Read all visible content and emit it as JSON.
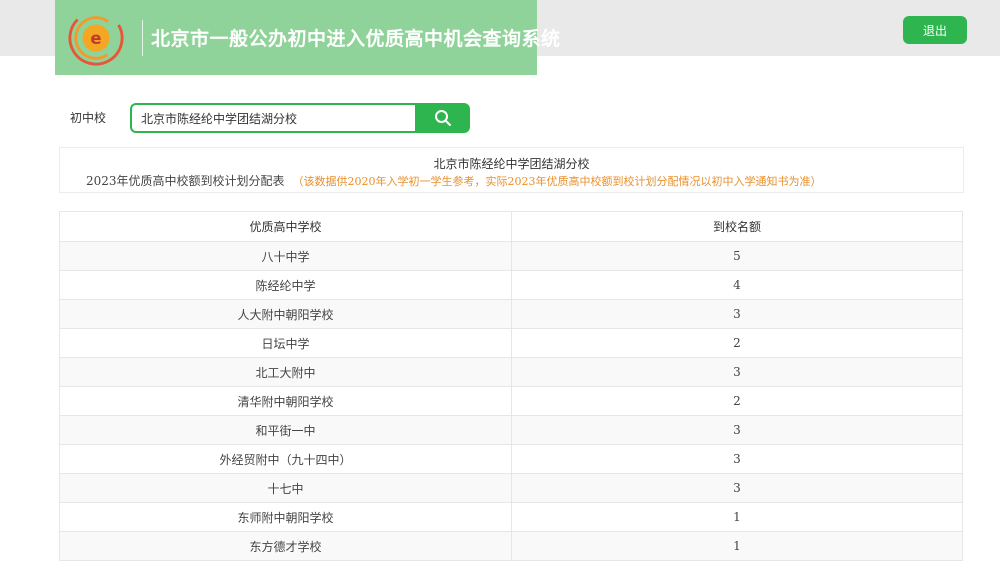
{
  "header": {
    "title": "北京市一般公办初中进入优质高中机会查询系统",
    "logout_label": "退出",
    "brand_color": "#8fd39a",
    "accent_color": "#2fb550"
  },
  "search": {
    "label": "初中校",
    "value": "北京市陈经纶中学团结湖分校",
    "button_icon": "search-icon"
  },
  "info": {
    "school_name": "北京市陈经纶中学团结湖分校",
    "plan_title": "2023年优质高中校额到校计划分配表",
    "note": "（该数据供2020年入学初一学生参考，实际2023年优质高中校额到校计划分配情况以初中入学通知书为准）",
    "note_color": "#e8902e"
  },
  "table": {
    "headers": [
      "优质高中学校",
      "到校名额"
    ],
    "rows": [
      [
        "八十中学",
        "5"
      ],
      [
        "陈经纶中学",
        "4"
      ],
      [
        "人大附中朝阳学校",
        "3"
      ],
      [
        "日坛中学",
        "2"
      ],
      [
        "北工大附中",
        "3"
      ],
      [
        "清华附中朝阳学校",
        "2"
      ],
      [
        "和平街一中",
        "3"
      ],
      [
        "外经贸附中（九十四中）",
        "3"
      ],
      [
        "十七中",
        "3"
      ],
      [
        "东师附中朝阳学校",
        "1"
      ],
      [
        "东方德才学校",
        "1"
      ]
    ]
  }
}
